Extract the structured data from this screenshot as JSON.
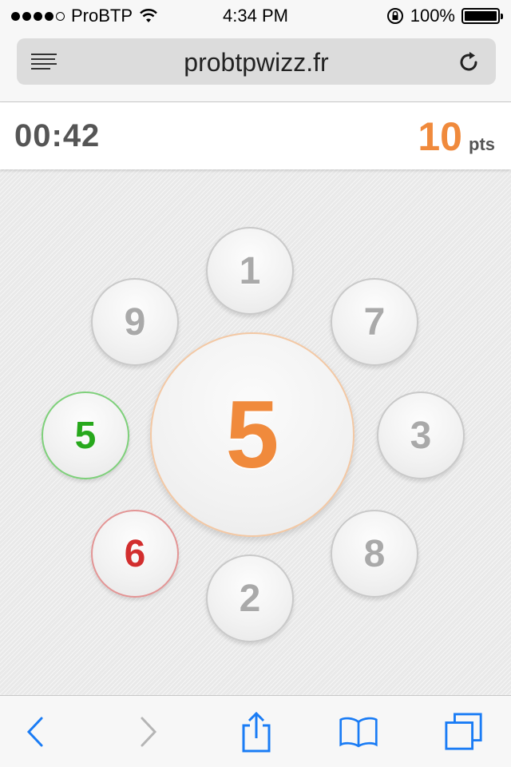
{
  "status_bar": {
    "carrier": "ProBTP",
    "time": "4:34 PM",
    "battery": "100%",
    "signal_icon": "signal-dots-icon",
    "wifi_icon": "wifi-icon",
    "lock_icon": "orientation-lock-icon"
  },
  "browser": {
    "url": "probtpwizz.fr",
    "menu_icon": "reader-list-icon",
    "reload_icon": "reload-icon"
  },
  "game": {
    "timer": "00:42",
    "score": "10",
    "score_unit": "pts",
    "target_number": "5",
    "bubbles": {
      "b1": "1",
      "b9": "9",
      "b7": "7",
      "b5": "5",
      "b3": "3",
      "b6": "6",
      "b8": "8",
      "b2": "2"
    },
    "colors": {
      "accent": "#f08a3c",
      "correct": "#27a81c",
      "wrong": "#d22e2e",
      "neutral": "#a9a9a9"
    }
  },
  "toolbar": {
    "back_icon": "back-chevron-icon",
    "forward_icon": "forward-chevron-icon",
    "share_icon": "share-icon",
    "bookmarks_icon": "bookmarks-book-icon",
    "tabs_icon": "tabs-icon",
    "icon_color": "#1a7cf5"
  }
}
